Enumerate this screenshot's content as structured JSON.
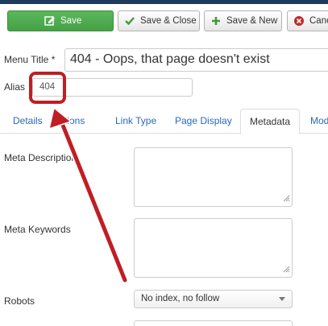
{
  "toolbar": {
    "save_label": "Save",
    "save_close_label": "Save & Close",
    "save_new_label": "Save & New",
    "cancel_label": "Canc"
  },
  "fields": {
    "menu_title_label": "Menu Title *",
    "menu_title_value": "404 - Oops, that page doesn't exist",
    "alias_label": "Alias",
    "alias_value": "404"
  },
  "tabs": {
    "details": "Details",
    "options": "Options",
    "link_type": "Link Type",
    "page_display": "Page Display",
    "metadata": "Metadata",
    "modules": "Mod"
  },
  "metadata": {
    "meta_description_label": "Meta Description",
    "meta_keywords_label": "Meta Keywords",
    "robots_label": "Robots",
    "robots_value": "No index, no follow"
  },
  "annotation": {
    "color": "#bf1e24"
  }
}
